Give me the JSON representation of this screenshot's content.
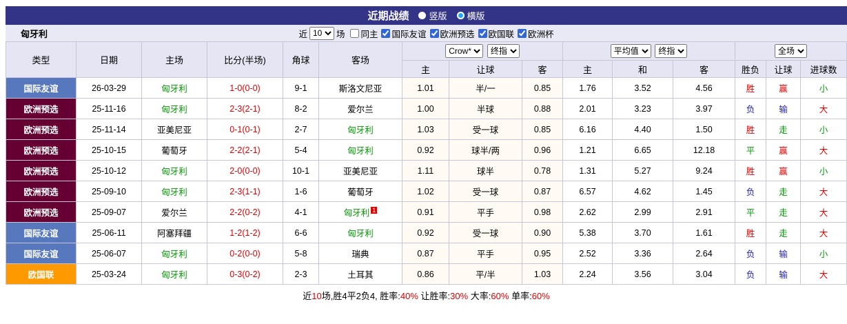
{
  "title_bar": {
    "title": "近期战绩",
    "radio_vertical": "竖版",
    "radio_horizontal": "横版",
    "selected": "横版"
  },
  "filter_bar": {
    "team": "匈牙利",
    "near_label": "近",
    "count_value": "10",
    "games_label": "场",
    "checkboxes": [
      {
        "key": "same-home",
        "label": "同主",
        "checked": false
      },
      {
        "key": "intl-friendly",
        "label": "国际友谊",
        "checked": true
      },
      {
        "key": "euro-qualifier",
        "label": "欧洲预选",
        "checked": true
      },
      {
        "key": "nations-league",
        "label": "欧国联",
        "checked": true
      },
      {
        "key": "euro-cup",
        "label": "欧洲杯",
        "checked": true
      }
    ]
  },
  "table": {
    "headers": {
      "type": "类型",
      "date": "日期",
      "home": "主场",
      "score": "比分(半场)",
      "corner": "角球",
      "away": "客场",
      "result": "胜负",
      "handicap_result": "让球",
      "goals": "进球数"
    },
    "subheaders": [
      "主",
      "让球",
      "客",
      "主",
      "和",
      "客"
    ],
    "selects": {
      "company": "Crow*",
      "stage1": "终指",
      "average": "平均值",
      "stage2": "终指",
      "scope": "全场"
    },
    "rows": [
      {
        "type": "国际友谊",
        "type_key": "friendly",
        "date": "26-03-29",
        "home": "匈牙利",
        "home_green": true,
        "score": "1-0",
        "half": "(0-0)",
        "corner": "9-1",
        "away": "斯洛文尼亚",
        "away_green": false,
        "away_mark": "",
        "h_home": "1.01",
        "h_line": "半/一",
        "h_away": "0.85",
        "o_home": "1.76",
        "o_draw": "3.52",
        "o_away": "4.56",
        "wdl": "胜",
        "wdl_c": "red",
        "cover": "赢",
        "cover_c": "red",
        "goals": "小",
        "goals_c": "green"
      },
      {
        "type": "欧洲预选",
        "type_key": "qualifier",
        "date": "25-11-16",
        "home": "匈牙利",
        "home_green": true,
        "score": "2-3",
        "half": "(2-1)",
        "corner": "8-2",
        "away": "爱尔兰",
        "away_green": false,
        "away_mark": "",
        "h_home": "1.00",
        "h_line": "半球",
        "h_away": "0.88",
        "o_home": "2.01",
        "o_draw": "3.23",
        "o_away": "3.97",
        "wdl": "负",
        "wdl_c": "blue",
        "cover": "输",
        "cover_c": "blue",
        "goals": "大",
        "goals_c": "red"
      },
      {
        "type": "欧洲预选",
        "type_key": "qualifier",
        "date": "25-11-14",
        "home": "亚美尼亚",
        "home_green": false,
        "score": "0-1",
        "half": "(0-1)",
        "corner": "2-7",
        "away": "匈牙利",
        "away_green": true,
        "away_mark": "",
        "h_home": "1.03",
        "h_line": "受一球",
        "h_away": "0.85",
        "o_home": "6.16",
        "o_draw": "4.40",
        "o_away": "1.50",
        "wdl": "胜",
        "wdl_c": "red",
        "cover": "走",
        "cover_c": "green",
        "goals": "小",
        "goals_c": "green"
      },
      {
        "type": "欧洲预选",
        "type_key": "qualifier",
        "date": "25-10-15",
        "home": "葡萄牙",
        "home_green": false,
        "score": "2-2",
        "half": "(2-1)",
        "corner": "5-4",
        "away": "匈牙利",
        "away_green": true,
        "away_mark": "",
        "h_home": "0.92",
        "h_line": "球半/两",
        "h_away": "0.96",
        "o_home": "1.21",
        "o_draw": "6.65",
        "o_away": "12.18",
        "wdl": "平",
        "wdl_c": "green",
        "cover": "赢",
        "cover_c": "red",
        "goals": "大",
        "goals_c": "red"
      },
      {
        "type": "欧洲预选",
        "type_key": "qualifier",
        "date": "25-10-12",
        "home": "匈牙利",
        "home_green": true,
        "score": "2-0",
        "half": "(0-0)",
        "corner": "10-1",
        "away": "亚美尼亚",
        "away_green": false,
        "away_mark": "",
        "h_home": "1.11",
        "h_line": "球半",
        "h_away": "0.78",
        "o_home": "1.31",
        "o_draw": "5.27",
        "o_away": "9.24",
        "wdl": "胜",
        "wdl_c": "red",
        "cover": "赢",
        "cover_c": "red",
        "goals": "小",
        "goals_c": "green"
      },
      {
        "type": "欧洲预选",
        "type_key": "qualifier",
        "date": "25-09-10",
        "home": "匈牙利",
        "home_green": true,
        "score": "2-3",
        "half": "(1-1)",
        "corner": "1-6",
        "away": "葡萄牙",
        "away_green": false,
        "away_mark": "",
        "h_home": "1.02",
        "h_line": "受一球",
        "h_away": "0.87",
        "o_home": "6.57",
        "o_draw": "4.62",
        "o_away": "1.45",
        "wdl": "负",
        "wdl_c": "blue",
        "cover": "走",
        "cover_c": "green",
        "goals": "大",
        "goals_c": "red"
      },
      {
        "type": "欧洲预选",
        "type_key": "qualifier",
        "date": "25-09-07",
        "home": "爱尔兰",
        "home_green": false,
        "score": "2-2",
        "half": "(0-2)",
        "corner": "4-1",
        "away": "匈牙利",
        "away_green": true,
        "away_mark": "1",
        "h_home": "0.91",
        "h_line": "平手",
        "h_away": "0.98",
        "o_home": "2.62",
        "o_draw": "2.99",
        "o_away": "2.91",
        "wdl": "平",
        "wdl_c": "green",
        "cover": "走",
        "cover_c": "green",
        "goals": "大",
        "goals_c": "red"
      },
      {
        "type": "国际友谊",
        "type_key": "friendly",
        "date": "25-06-11",
        "home": "阿塞拜疆",
        "home_green": false,
        "score": "1-2",
        "half": "(1-2)",
        "corner": "6-6",
        "away": "匈牙利",
        "away_green": true,
        "away_mark": "",
        "h_home": "0.92",
        "h_line": "受一球",
        "h_away": "0.90",
        "o_home": "5.38",
        "o_draw": "3.70",
        "o_away": "1.61",
        "wdl": "胜",
        "wdl_c": "red",
        "cover": "走",
        "cover_c": "green",
        "goals": "大",
        "goals_c": "red"
      },
      {
        "type": "国际友谊",
        "type_key": "friendly",
        "date": "25-06-07",
        "home": "匈牙利",
        "home_green": true,
        "score": "0-2",
        "half": "(0-0)",
        "corner": "5-8",
        "away": "瑞典",
        "away_green": false,
        "away_mark": "",
        "h_home": "0.87",
        "h_line": "平手",
        "h_away": "0.95",
        "o_home": "2.52",
        "o_draw": "3.36",
        "o_away": "2.64",
        "wdl": "负",
        "wdl_c": "blue",
        "cover": "输",
        "cover_c": "blue",
        "goals": "小",
        "goals_c": "green"
      },
      {
        "type": "欧国联",
        "type_key": "nations",
        "date": "25-03-24",
        "home": "匈牙利",
        "home_green": true,
        "score": "0-3",
        "half": "(0-2)",
        "corner": "2-3",
        "away": "土耳其",
        "away_green": false,
        "away_mark": "",
        "h_home": "0.86",
        "h_line": "平/半",
        "h_away": "1.03",
        "o_home": "2.24",
        "o_draw": "3.56",
        "o_away": "3.04",
        "wdl": "负",
        "wdl_c": "blue",
        "cover": "输",
        "cover_c": "blue",
        "goals": "大",
        "goals_c": "red"
      }
    ]
  },
  "footer": {
    "t1": "近",
    "n1": "10",
    "t2": "场,胜4平2负4, 胜率:",
    "p1": "40%",
    "t3": " 让胜率:",
    "p2": "30%",
    "t4": " 大率:",
    "p3": "60%",
    "t5": " 单率:",
    "p4": "60%"
  },
  "colors": {
    "friendly": "#5878BE",
    "qualifier": "#660033",
    "nations": "#FF9900",
    "red": "#E60000",
    "blue": "#2323CC",
    "green": "#009900",
    "title_bar_bg": "#333388",
    "filter_bar_bg": "#E9E9F5",
    "header_cell_bg": "#E5E5F3"
  }
}
